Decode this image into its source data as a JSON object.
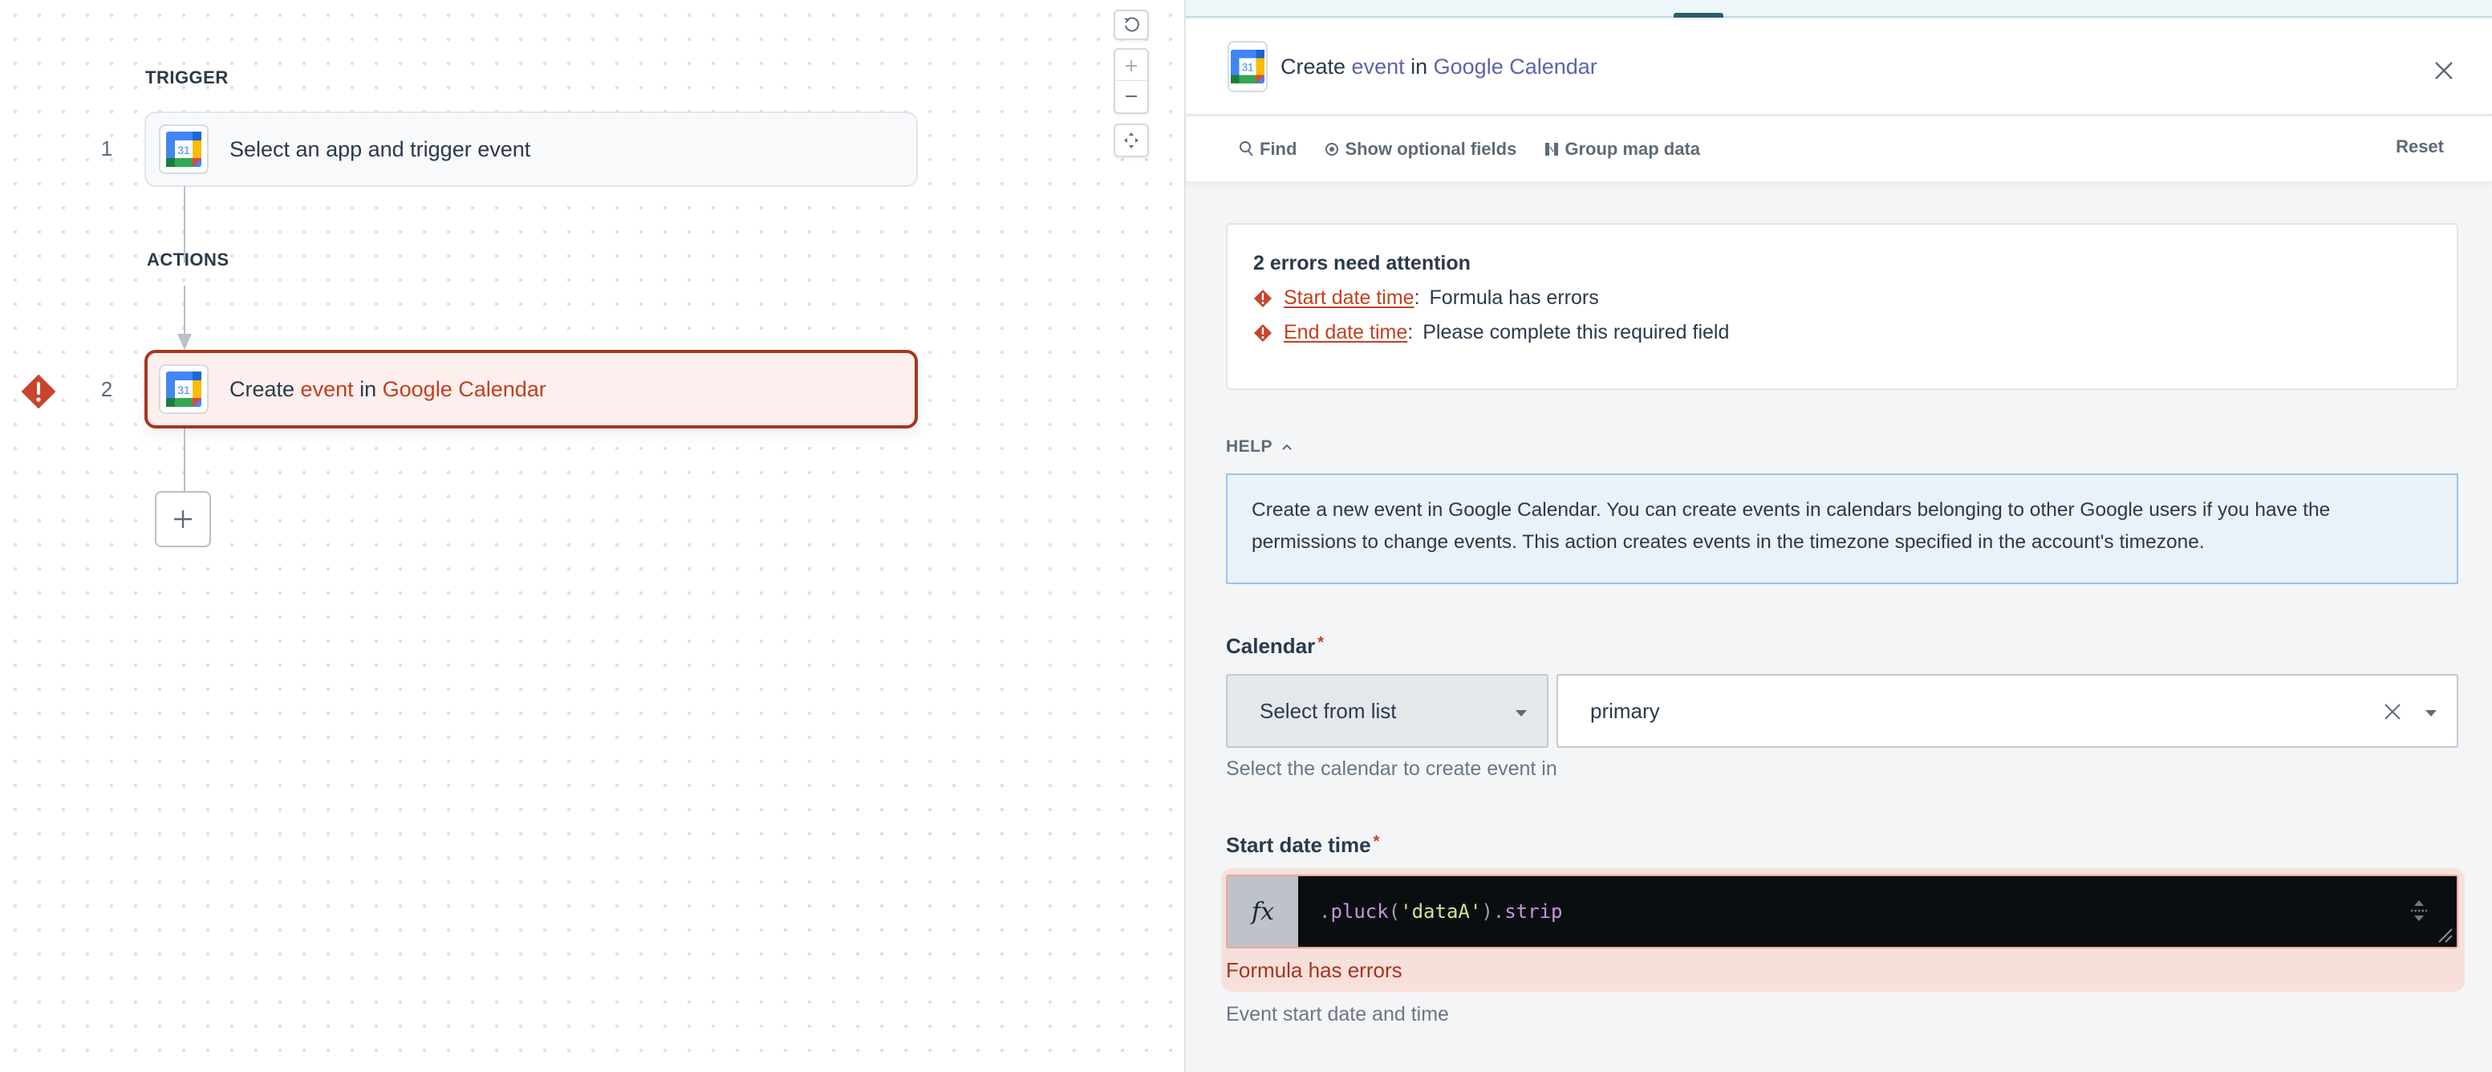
{
  "canvas": {
    "trigger_label": "TRIGGER",
    "actions_label": "ACTIONS",
    "controls": {
      "reset_icon": "reset-icon",
      "zoom_in_icon": "plus-icon",
      "zoom_out_icon": "minus-icon",
      "fit_icon": "fit-view-icon"
    },
    "steps": [
      {
        "number": "1",
        "app_icon": "google-calendar-icon",
        "app_icon_text": "31",
        "title": "Select an app and trigger event",
        "status": "normal"
      },
      {
        "number": "2",
        "app_icon": "google-calendar-icon",
        "app_icon_text": "31",
        "title_parts": {
          "prefix": "Create ",
          "action": "event",
          "mid": " in ",
          "app": "Google Calendar"
        },
        "status": "error",
        "status_icon": "error-diamond-icon"
      }
    ],
    "add_step_icon": "plus-icon"
  },
  "panel": {
    "header": {
      "app_icon_text": "31",
      "title_parts": {
        "prefix": "Create ",
        "action": "event",
        "mid": " in ",
        "app": "Google Calendar"
      },
      "close_icon": "close-icon"
    },
    "toolbar": {
      "find": "Find",
      "show_optional": "Show optional fields",
      "group_map": "Group map data",
      "reset": "Reset"
    },
    "errors": {
      "heading": "2 errors need attention",
      "items": [
        {
          "field": "Start date time",
          "sep": ":",
          "message": "Formula has errors"
        },
        {
          "field": "End date time",
          "sep": ":",
          "message": "Please complete this required field"
        }
      ]
    },
    "help": {
      "label": "HELP",
      "text": "Create a new event in Google Calendar. You can create events in calendars belonging to other Google users if you have the permissions to change events. This action creates events in the timezone specified in the account's timezone."
    },
    "fields": {
      "calendar": {
        "label": "Calendar",
        "required_mark": "*",
        "mode": "Select from list",
        "value": "primary",
        "hint": "Select the calendar to create event in"
      },
      "start_date_time": {
        "label": "Start date time",
        "required_mark": "*",
        "fx_label": "fx",
        "formula_tokens": [
          {
            "t": ".",
            "c": "c-dot"
          },
          {
            "t": "pluck",
            "c": "c-fn"
          },
          {
            "t": "(",
            "c": "c-paren"
          },
          {
            "t": "'dataA'",
            "c": "c-str"
          },
          {
            "t": ")",
            "c": "c-paren"
          },
          {
            "t": ".",
            "c": "c-dot"
          },
          {
            "t": "strip",
            "c": "c-fn"
          }
        ],
        "error": "Formula has errors",
        "hint": "Event start date and time"
      }
    }
  },
  "colors": {
    "error": "#c2401f",
    "error_border": "#a8351f",
    "error_bg": "#fcefee",
    "link_accent": "#5a64b0",
    "help_bg": "#e9f1f9",
    "help_border": "#9fc3ea",
    "formula_bg": "#0b0e10"
  }
}
